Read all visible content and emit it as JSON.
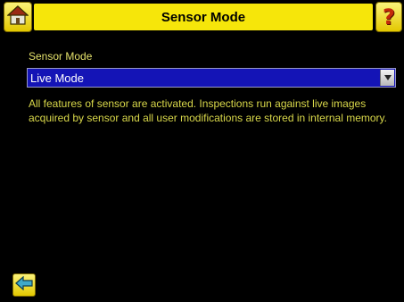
{
  "header": {
    "title": "Sensor Mode",
    "home_icon": "home-icon",
    "help_icon": "help-icon",
    "help_glyph": "?"
  },
  "form": {
    "field_label": "Sensor Mode",
    "selected_value": "Live Mode",
    "dropdown_icon": "chevron-down-icon"
  },
  "description": "All features of sensor are activated. Inspections run against live images acquired by sensor and all user modifications are stored in internal memory.",
  "footer": {
    "back_icon": "back-arrow-icon"
  },
  "colors": {
    "title_bar": "#f6e60a",
    "text_accent": "#d9d84a",
    "select_bg": "#1414b6",
    "background": "#000000"
  }
}
